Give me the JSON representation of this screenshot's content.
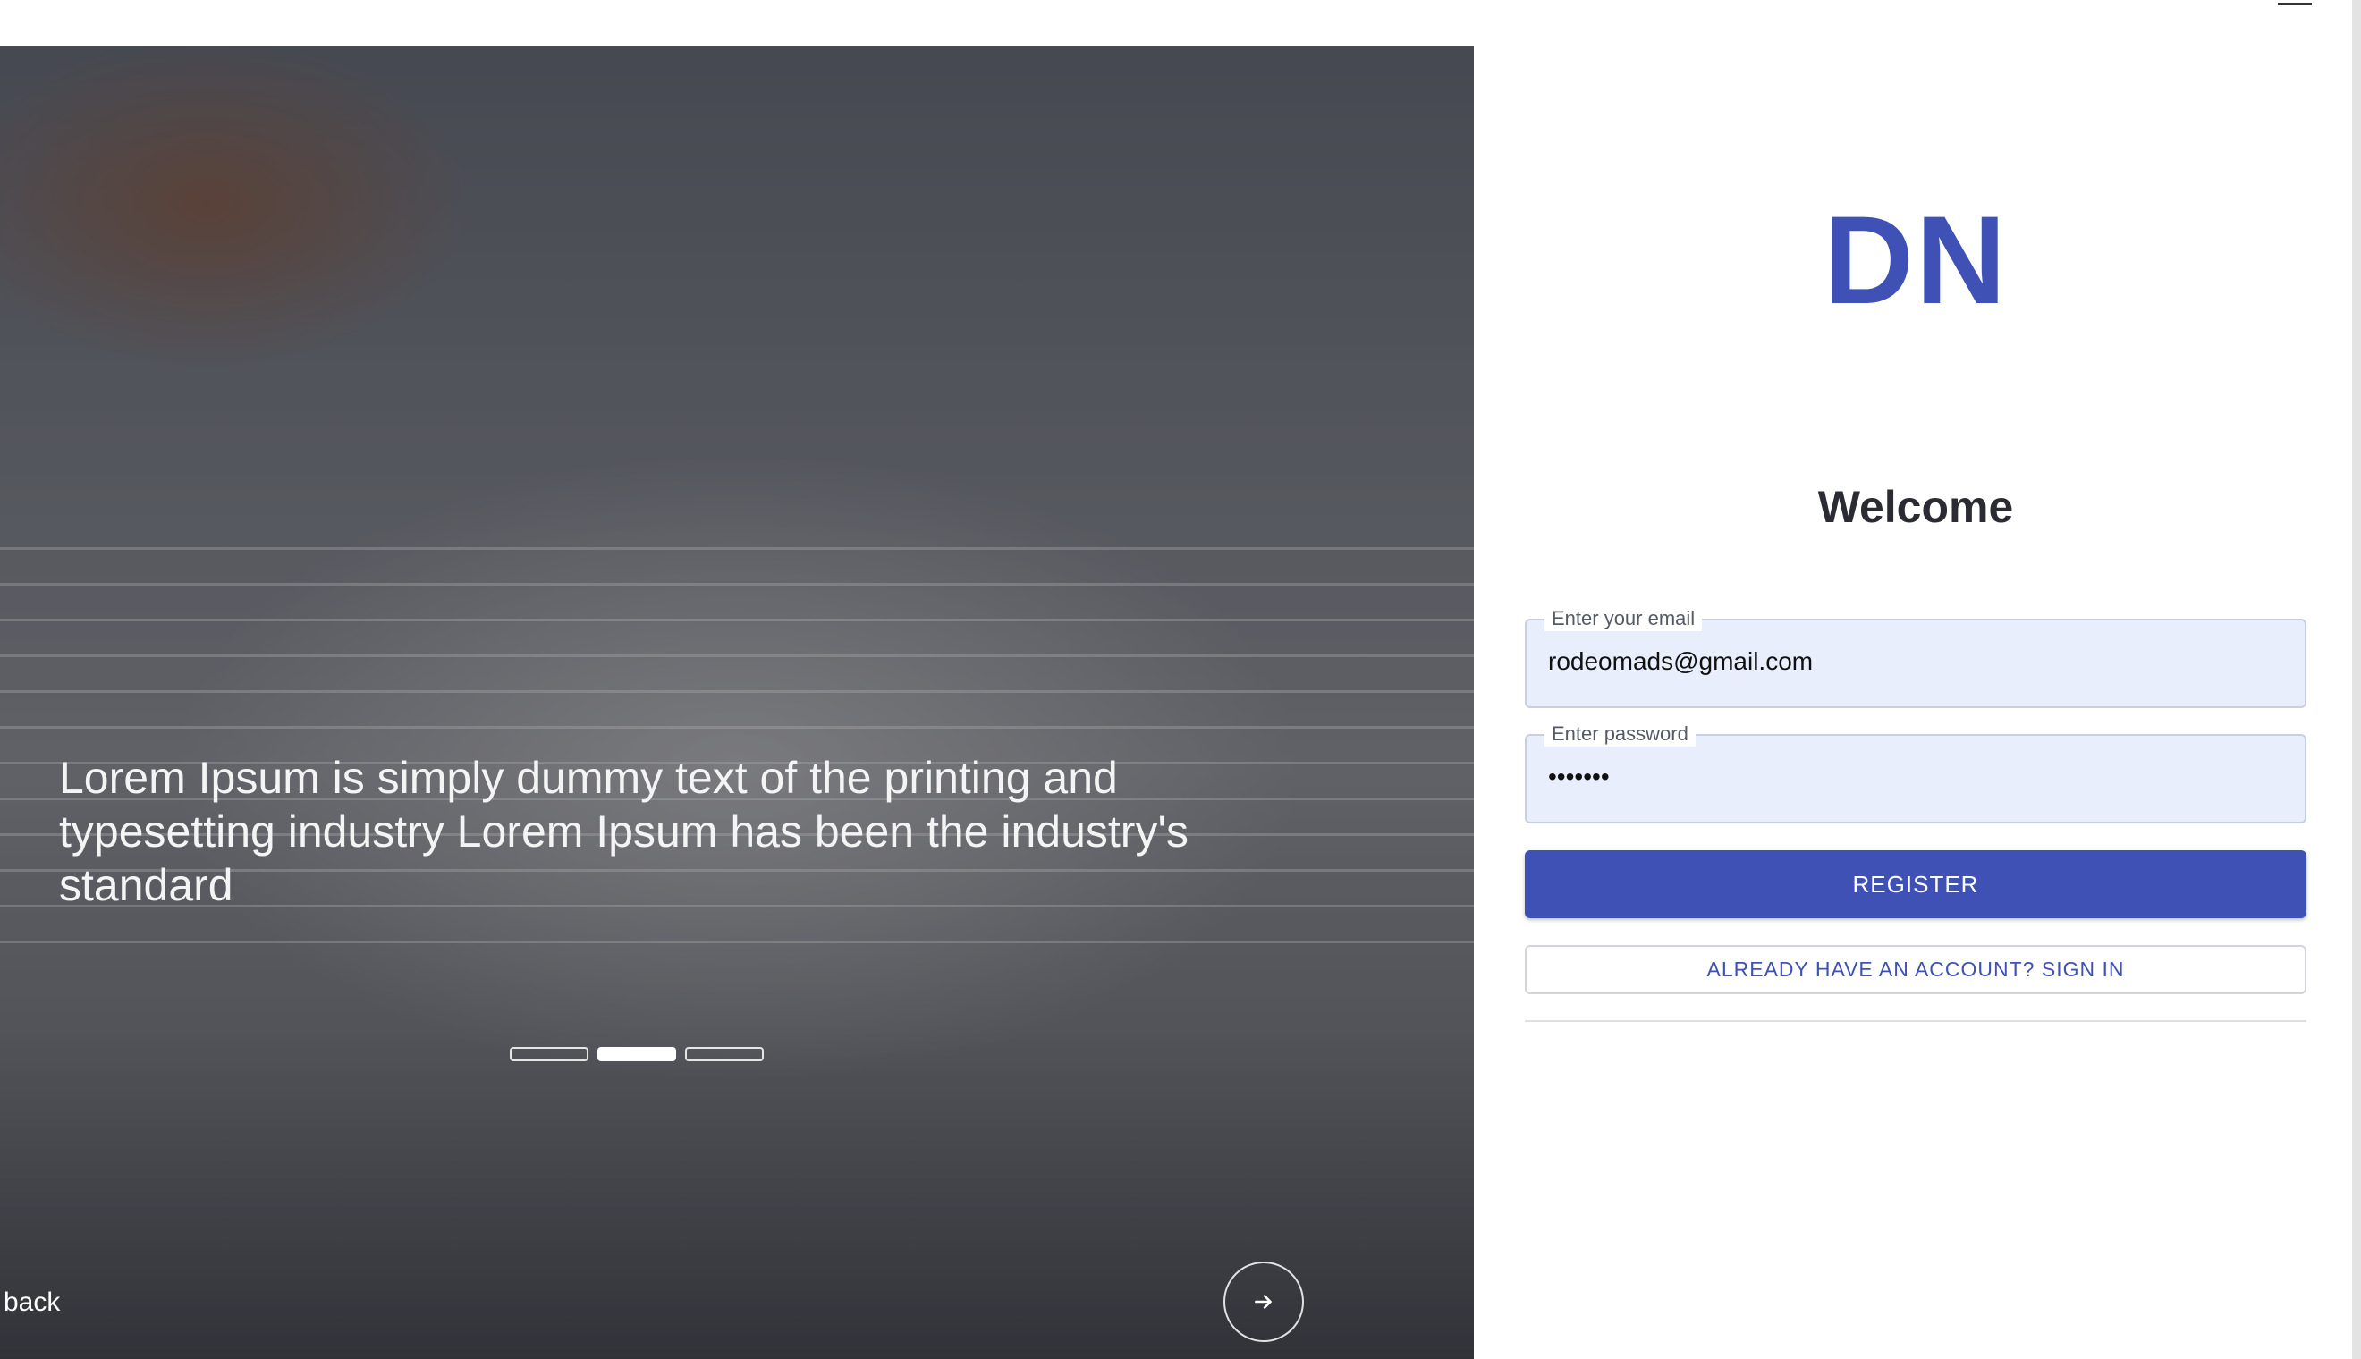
{
  "hero": {
    "caption": "Lorem Ipsum is simply dummy text of the printing and typesetting industry Lorem Ipsum has been the industry's standard",
    "carousel_total": 3,
    "carousel_active_index": 1,
    "back_label": "back",
    "next_icon": "arrow-right-icon"
  },
  "header": {
    "menu_icon": "hamburger-icon"
  },
  "form": {
    "logo_text": "DN",
    "title": "Welcome",
    "email": {
      "label": "Enter your email",
      "value": "rodeomads@gmail.com"
    },
    "password": {
      "label": "Enter password",
      "value": "•••••••"
    },
    "register_label": "REGISTER",
    "signin_label": "ALREADY HAVE AN ACCOUNT? SIGN IN"
  },
  "colors": {
    "primary": "#3f51b5",
    "input_bg": "#e8eefc"
  }
}
